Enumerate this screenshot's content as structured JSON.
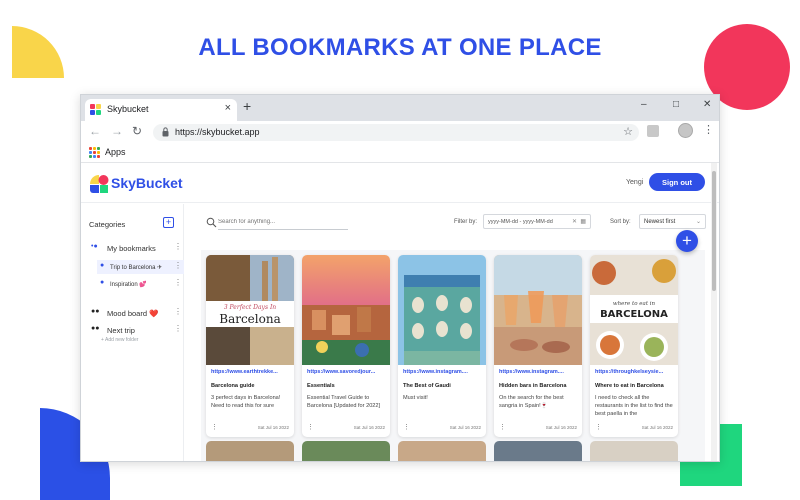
{
  "headline": "ALL BOOKMARKS AT ONE PLACE",
  "browser": {
    "tab_title": "Skybucket",
    "tab_close": "×",
    "new_tab": "+",
    "url": "https://skybucket.app",
    "bookmarks_bar": {
      "apps_label": "Apps"
    }
  },
  "app": {
    "logo_text": "SkyBucket",
    "username": "Yengi",
    "signout_label": "Sign out",
    "sidebar": {
      "title": "Categories",
      "folders": [
        {
          "label": "My bookmarks",
          "bullet": "•● "
        },
        {
          "label": "Trip to Barcelona ✈",
          "bullet": "●"
        },
        {
          "label": "Inspiration 💕",
          "bullet": "●"
        },
        {
          "label": "Mood board ❤️",
          "bullet": "●●"
        },
        {
          "label": "Next trip",
          "bullet": "●●"
        }
      ],
      "add_folder": "+ Add new folder"
    },
    "search": {
      "placeholder": "Search for anything..."
    },
    "filter": {
      "label": "Filter by:",
      "date_placeholder": "yyyy-MM-dd - yyyy-MM-dd"
    },
    "sort": {
      "label": "Sort by:",
      "value": "Newest first"
    },
    "cards": [
      {
        "url": "https://www.earthtrekke...",
        "title": "Barcelona guide",
        "note": "3 perfect days in Barcelona! Need to read this for sure",
        "date": "Sat Jul 16 2022",
        "thumb_text_top": "3 Perfect Days In",
        "thumb_text_main": "Barcelona"
      },
      {
        "url": "https://www.savoredjour...",
        "title": "Essentials",
        "note": "Essential Travel Guide to Barcelona [Updated for 2022]",
        "date": "Sat Jul 16 2022"
      },
      {
        "url": "https://www.instagram....",
        "title": "The Best of Gaudi",
        "note": "Must visit!",
        "date": "Sat Jul 16 2022"
      },
      {
        "url": "https://www.instagram....",
        "title": "Hidden bars in Barcelona",
        "note": "On the search for the best sangria in Spain!🍷",
        "date": "Sat Jul 16 2022"
      },
      {
        "url": "https://throughkelseysie...",
        "title": "Where to eat in Barcelona",
        "note": "I need to check all the restaurants in the list to find the best paella in the",
        "date": "Sat Jul 16 2022",
        "thumb_text_top": "where to eat in",
        "thumb_text_main": "BARCELONA"
      }
    ]
  },
  "colors": {
    "brand": "#2f4fe6",
    "accent_red": "#f2365b",
    "accent_yellow": "#f9d54a",
    "accent_green": "#1fd67e"
  }
}
